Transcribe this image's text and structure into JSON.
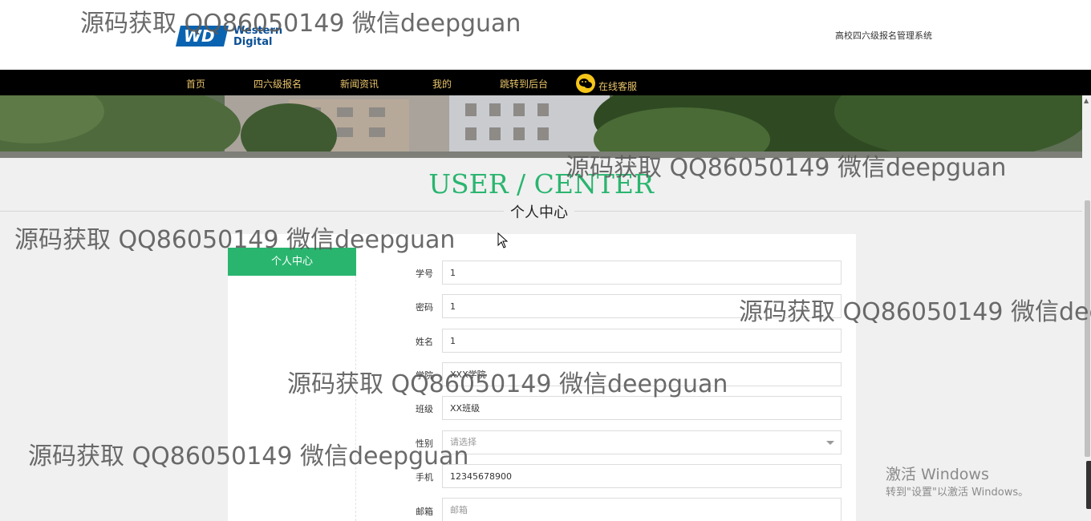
{
  "header": {
    "logo_text": "Western Digital",
    "site_title": "高校四六级报名管理系统"
  },
  "nav": {
    "items": [
      "首页",
      "四六级报名",
      "新闻资讯",
      "我的",
      "跳转到后台"
    ],
    "service": "在线客服"
  },
  "page": {
    "title_en": "USER / CENTER",
    "title_cn": "个人中心"
  },
  "sidebar": {
    "items": [
      {
        "label": "个人中心"
      }
    ]
  },
  "form": {
    "fields": [
      {
        "label": "学号",
        "value": "1"
      },
      {
        "label": "密码",
        "value": "1"
      },
      {
        "label": "姓名",
        "value": "1"
      },
      {
        "label": "学院",
        "value": "XXX学院"
      },
      {
        "label": "班级",
        "value": "XX班级"
      },
      {
        "label": "性别",
        "placeholder": "请选择"
      },
      {
        "label": "手机",
        "value": "12345678900"
      },
      {
        "label": "邮箱",
        "value": "",
        "placeholder": "邮箱"
      }
    ]
  },
  "watermark": {
    "text": "源码获取 QQ86050149 微信deepguan"
  },
  "os_notice": {
    "line1": "激活 Windows",
    "line2": "转到\"设置\"以激活 Windows。"
  }
}
